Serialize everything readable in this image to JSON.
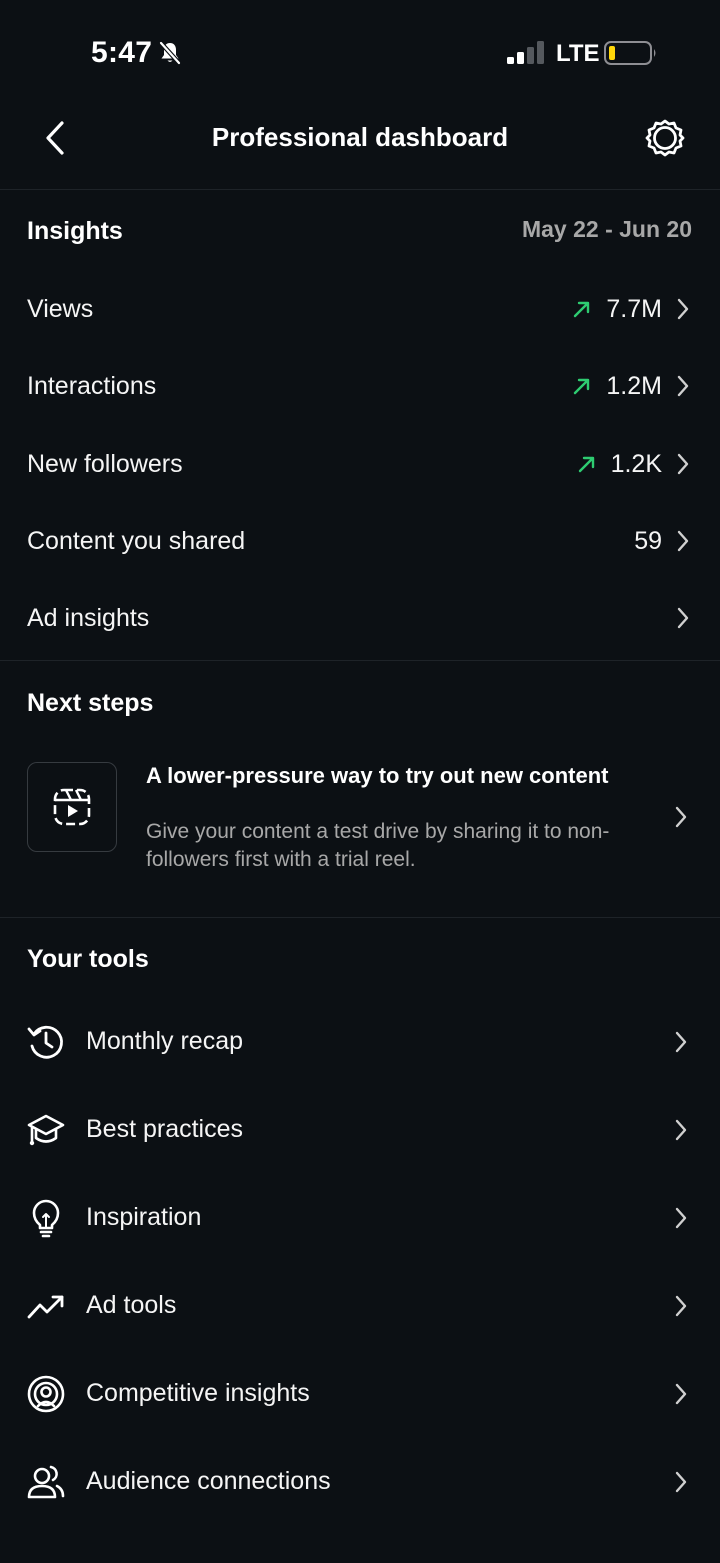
{
  "status_bar": {
    "time": "5:47",
    "network": "LTE",
    "icons": [
      "bell-slash-icon",
      "signal-icon",
      "battery-icon"
    ]
  },
  "header": {
    "title": "Professional dashboard",
    "back_icon": "chevron-left-icon",
    "settings_icon": "settings-gear-icon"
  },
  "insights": {
    "title": "Insights",
    "date_range": "May 22 - Jun 20",
    "rows": [
      {
        "label": "Views",
        "value": "7.7M",
        "trend": "up"
      },
      {
        "label": "Interactions",
        "value": "1.2M",
        "trend": "up"
      },
      {
        "label": "New followers",
        "value": "1.2K",
        "trend": "up"
      },
      {
        "label": "Content you shared",
        "value": "59",
        "trend": ""
      },
      {
        "label": "Ad insights",
        "value": "",
        "trend": ""
      }
    ]
  },
  "next_steps": {
    "title": "Next steps",
    "card": {
      "icon": "reels-icon",
      "title": "A lower-pressure way to try out new content",
      "description": "Give your content a test drive by sharing it to non-followers first with a trial reel."
    }
  },
  "tools": {
    "title": "Your tools",
    "items": [
      {
        "label": "Monthly recap",
        "icon": "history-icon"
      },
      {
        "label": "Best practices",
        "icon": "graduation-cap-icon"
      },
      {
        "label": "Inspiration",
        "icon": "lightbulb-icon"
      },
      {
        "label": "Ad tools",
        "icon": "trending-up-icon"
      },
      {
        "label": "Competitive insights",
        "icon": "broadcast-icon"
      },
      {
        "label": "Audience connections",
        "icon": "people-icon"
      }
    ]
  },
  "colors": {
    "background": "#0c1014",
    "trend_up": "#2ecc71",
    "secondary_text": "#a8a8a8",
    "battery_low": "#ffd60a"
  }
}
